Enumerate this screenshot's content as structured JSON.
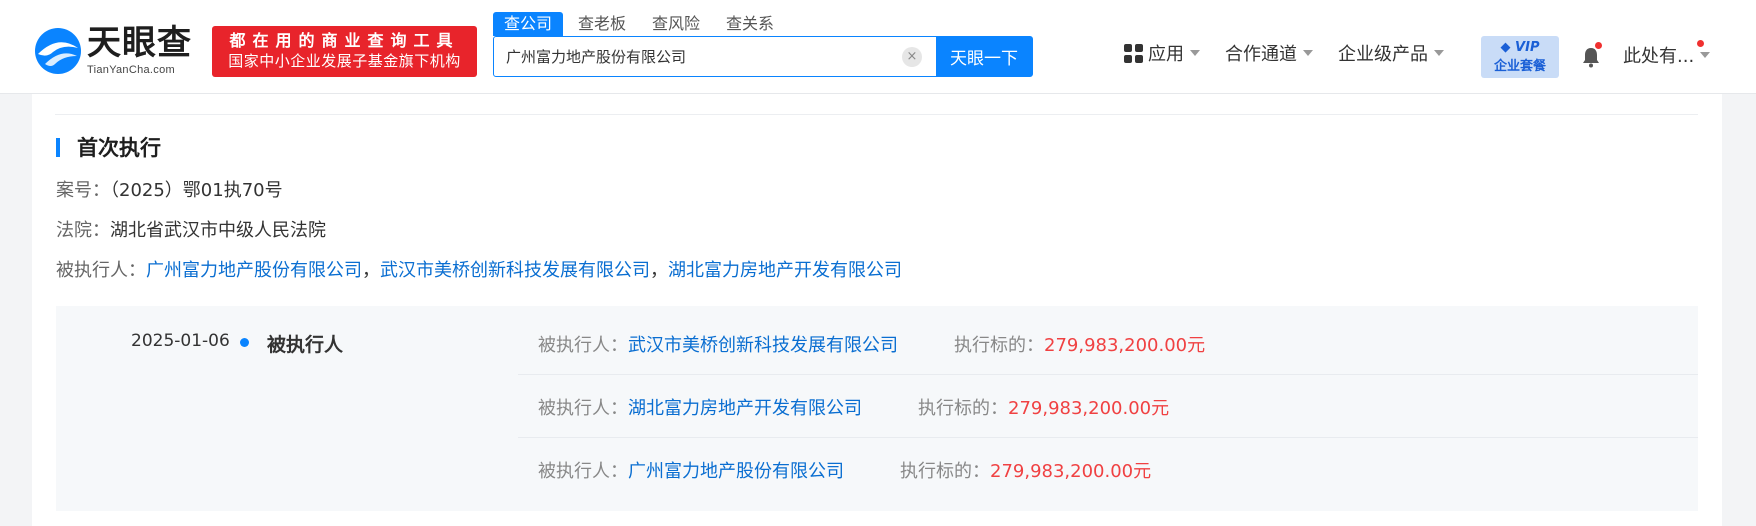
{
  "header": {
    "logo_cn": "天眼查",
    "logo_en": "TianYanCha.com",
    "slogan_line1": "都在用的商业查询工具",
    "slogan_line2": "国家中小企业发展子基金旗下机构",
    "search_tabs": [
      "查公司",
      "查老板",
      "查风险",
      "查关系"
    ],
    "search_value": "广州富力地产股份有限公司",
    "search_button": "天眼一下",
    "clear_glyph": "×",
    "nav": {
      "apps": "应用",
      "channels": "合作通道",
      "enterprise": "企业级产品"
    },
    "vip_line1": "VIP",
    "vip_line2": "企业套餐",
    "user": "此处有..."
  },
  "section": {
    "title": "首次执行",
    "case_label": "案号：",
    "case_value": "（2025）鄂01执70号",
    "court_label": "法院：",
    "court_value": "湖北省武汉市中级人民法院",
    "executed_label": "被执行人：",
    "executed_companies": [
      "广州富力地产股份有限公司",
      "武汉市美桥创新科技发展有限公司",
      "湖北富力房地产开发有限公司"
    ],
    "separator": "，"
  },
  "detail": {
    "date": "2025-01-06",
    "role": "被执行人",
    "rows": [
      {
        "label": "被执行人：",
        "company": "武汉市美桥创新科技发展有限公司",
        "amount_label": "执行标的：",
        "amount": "279,983,200.00元"
      },
      {
        "label": "被执行人：",
        "company": "湖北富力房地产开发有限公司",
        "amount_label": "执行标的：",
        "amount": "279,983,200.00元"
      },
      {
        "label": "被执行人：",
        "company": "广州富力地产股份有限公司",
        "amount_label": "执行标的：",
        "amount": "279,983,200.00元"
      }
    ]
  },
  "colors": {
    "brand_blue": "#0a84ff",
    "link_blue": "#0a6ed1",
    "amount_red": "#f04142",
    "slogan_red": "#e8242b"
  }
}
